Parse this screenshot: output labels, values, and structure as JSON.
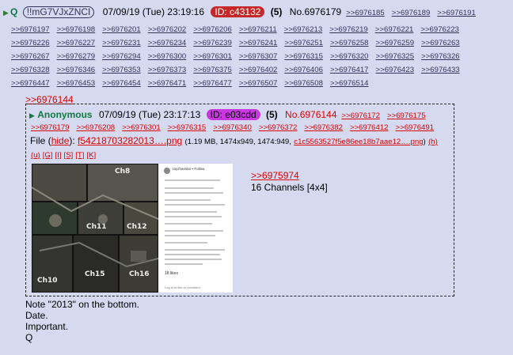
{
  "post": {
    "name": "Q",
    "tripcode": "!!mG7VJxZNCI",
    "datetime": "07/09/19 (Tue) 23:19:16",
    "id_label": "ID: c43132",
    "reply_count": "(5)",
    "post_number": "No.6976179",
    "backlink_rows": [
      [
        ">>6976185",
        ">>6976189",
        ">>6976191"
      ],
      [
        ">>6976197",
        ">>6976198",
        ">>6976201",
        ">>6976202",
        ">>6976206",
        ">>6976211",
        ">>6976213",
        ">>6976219",
        ">>6976221",
        ">>6976223"
      ],
      [
        ">>6976226",
        ">>6976227",
        ">>6976231",
        ">>6976234",
        ">>6976239",
        ">>6976241",
        ">>6976251",
        ">>6976258",
        ">>6976259",
        ">>6976263"
      ],
      [
        ">>6976267",
        ">>6976279",
        ">>6976294",
        ">>6976300",
        ">>6976301",
        ">>6976307",
        ">>6976315",
        ">>6976320",
        ">>6976325",
        ">>6976326"
      ],
      [
        ">>6976328",
        ">>6976346",
        ">>6976353",
        ">>6976373",
        ">>6976375",
        ">>6976402",
        ">>6976406",
        ">>6976417",
        ">>6976423",
        ">>6976433"
      ],
      [
        ">>6976447",
        ">>6976453",
        ">>6976454",
        ">>6976471",
        ">>6976477",
        ">>6976507",
        ">>6976508",
        ">>6976514"
      ]
    ],
    "quote_link": ">>6976144",
    "message_lines": [
      "Note \"2013\" on the bottom.",
      "Date.",
      "Important.",
      "Q"
    ]
  },
  "quoted": {
    "name": "Anonymous",
    "datetime": "07/09/19 (Tue) 23:17:13",
    "id_label": "ID: e03cdd",
    "reply_count": "(5)",
    "post_number": "No.6976144",
    "backlinks_first": [
      ">>6976172",
      ">>6976175"
    ],
    "backlinks_second": [
      ">>6976179",
      ">>6976208",
      ">>6976301",
      ">>6976315",
      ">>6976340",
      ">>6976372",
      ">>6976382",
      ">>6976412",
      ">>6976491"
    ],
    "file_label": "File",
    "hide_label": "hide",
    "file_name": "f54218703282013….png",
    "file_info": "(1.19 MB, 1474x949, 1474:949,",
    "file_hash": "c1c5563527f5e86ee18b7aae12….png",
    "file_h": "(h)",
    "tools": [
      "(u)",
      "[G]",
      "[I]",
      "[S]",
      "[T]",
      "[K]"
    ],
    "reply_link": ">>6975974",
    "reply_text": "16 Channels [4x4]",
    "image_labels": [
      "Ch8",
      "Ch12",
      "Ch15",
      "Ch16",
      "Ch10",
      "Ch11"
    ],
    "image_caption": "rayzhamilar • Follow",
    "image_likes": "18 likes",
    "image_login": "Log in to like or comment"
  },
  "colors": {
    "background": "#d6daf0",
    "link": "#34345c",
    "quote_red": "#dd0000",
    "name_green": "#117743",
    "id_red": "#c62828",
    "id_magenta": "#c837e0"
  }
}
